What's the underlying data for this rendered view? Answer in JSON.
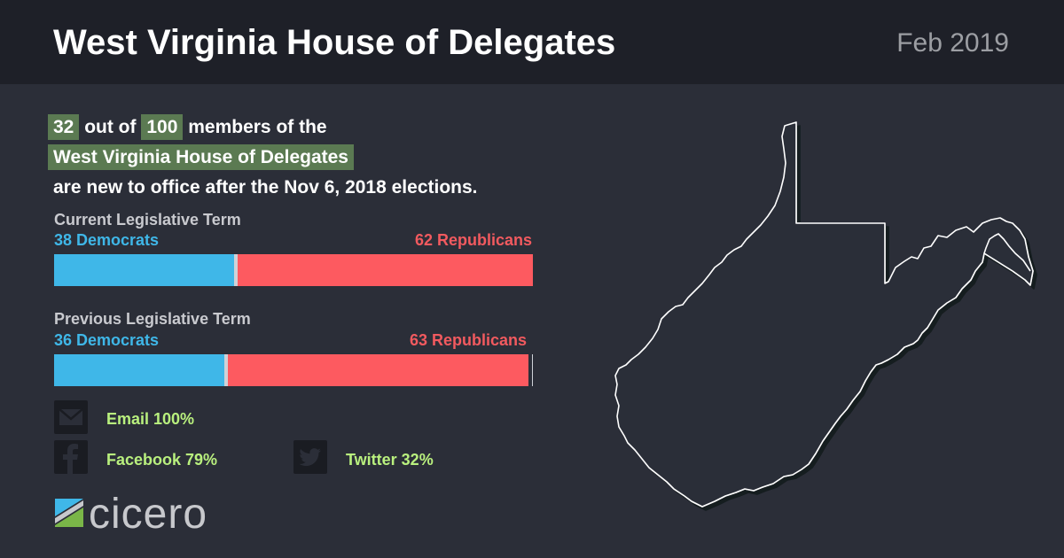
{
  "header": {
    "title": "West Virginia House of Delegates",
    "date": "Feb 2019"
  },
  "summary": {
    "new_count": "32",
    "mid1": " out of ",
    "total": "100",
    "mid2": " members of the",
    "body_name": "West Virginia House of Delegates",
    "end": "are new to office after the Nov 6, 2018 elections."
  },
  "current_term": {
    "label": "Current Legislative Term",
    "dem_label": "38 Democrats",
    "rep_label": "62 Republicans",
    "dem": 38,
    "rep": 62,
    "other": 0,
    "total": 100
  },
  "previous_term": {
    "label": "Previous Legislative Term",
    "dem_label": "36 Democrats",
    "rep_label": "63 Republicans",
    "dem": 36,
    "rep": 63,
    "other": 1,
    "total": 100
  },
  "social": {
    "email": "Email 100%",
    "facebook": "Facebook 79%",
    "twitter": "Twitter 32%"
  },
  "brand": {
    "logo_text": "cicero"
  },
  "colors": {
    "democrat": "#3fb7e8",
    "republican": "#fd5a60",
    "highlight": "#5b7a52",
    "social_text": "#b9f07e"
  },
  "icons": {
    "email": "envelope-icon",
    "facebook": "facebook-icon",
    "twitter": "twitter-icon",
    "map": "west-virginia-map"
  }
}
